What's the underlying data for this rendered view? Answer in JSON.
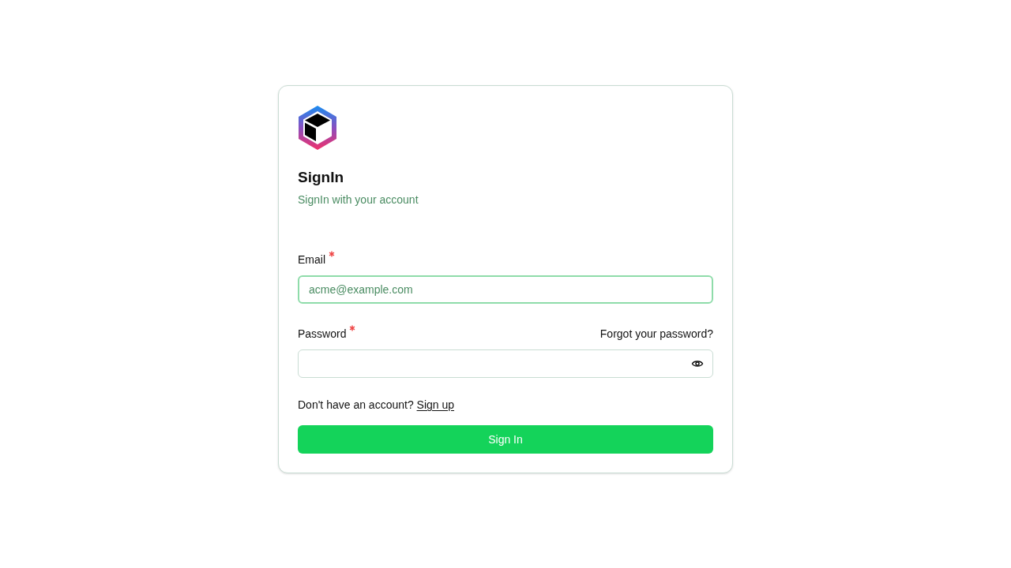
{
  "title": "SignIn",
  "subtitle": "SignIn with your account",
  "fields": [
    {
      "kind": "email",
      "label": "Email",
      "required": true,
      "placeholder": "acme@example.com",
      "focused": true
    },
    {
      "kind": "password",
      "label": "Password",
      "required": true,
      "focused": false,
      "link": "Forgot your password?"
    }
  ],
  "signup_prompt": "Don't have an account?",
  "signup_link": "Sign up",
  "submit": "Sign In"
}
